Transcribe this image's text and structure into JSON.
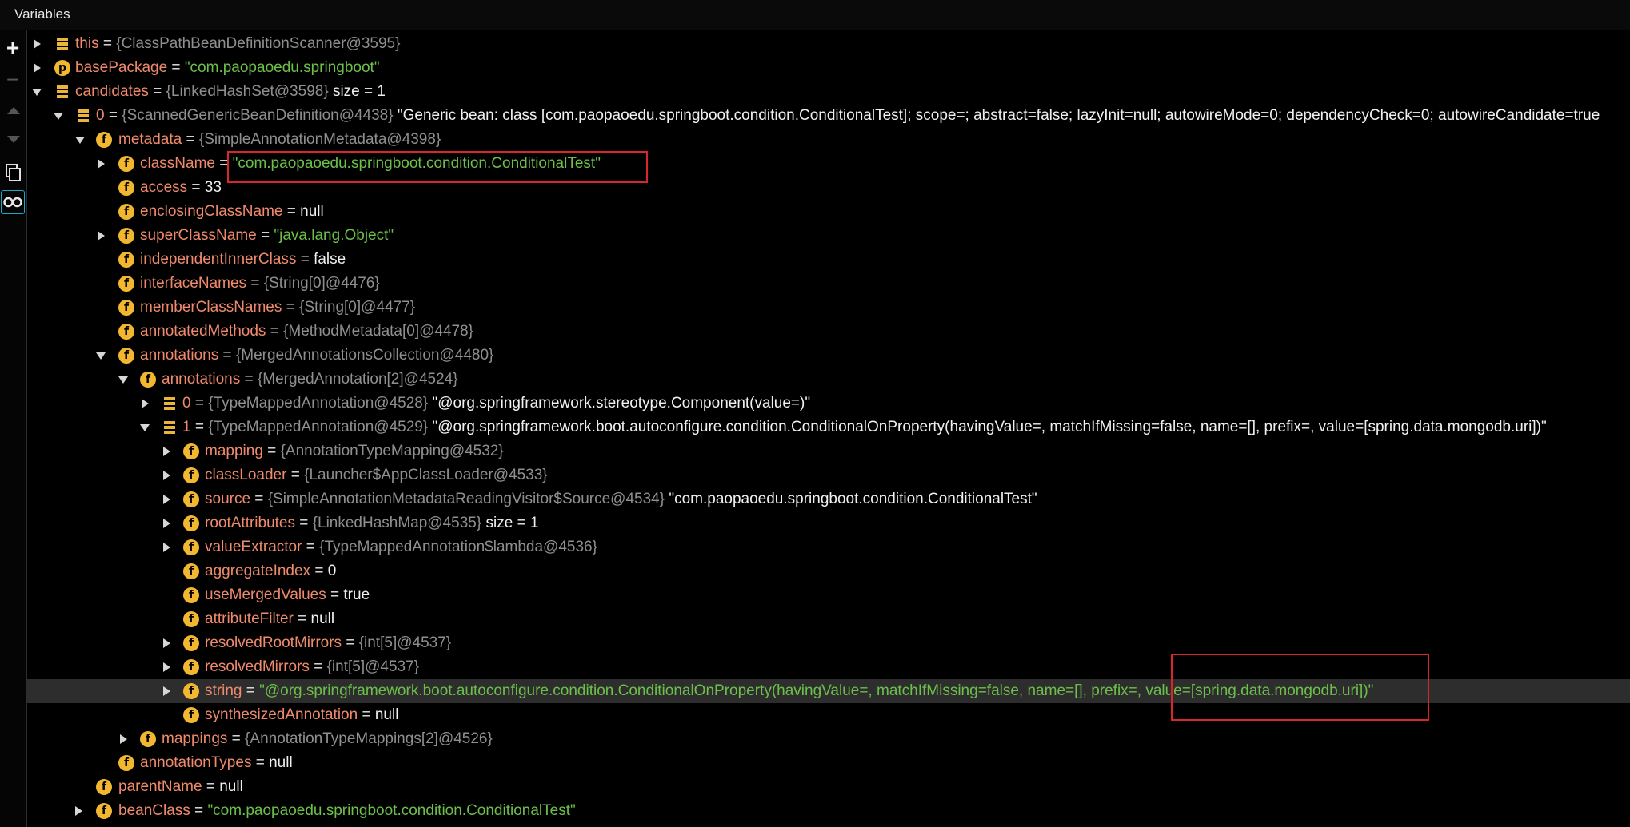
{
  "panel": {
    "title": "Variables"
  },
  "toolbar": {
    "add": "+",
    "remove": "−"
  },
  "rows": [
    {
      "name": "this",
      "ref": "{ClassPathBeanDefinitionScanner@3595}"
    },
    {
      "name": "basePackage",
      "icon_label": "p",
      "value": "\"com.paopaoedu.springboot\""
    },
    {
      "name": "candidates",
      "ref": "{LinkedHashSet@3598}",
      "extra": " size = 1"
    },
    {
      "name": "0",
      "ref": "{ScannedGenericBeanDefinition@4438}",
      "value": " \"Generic bean: class [com.paopaoedu.springboot.condition.ConditionalTest]; scope=; abstract=false; lazyInit=null; autowireMode=0; dependencyCheck=0; autowireCandidate=true"
    },
    {
      "name": "metadata",
      "icon_label": "f",
      "ref": "{SimpleAnnotationMetadata@4398}"
    },
    {
      "name": "className",
      "icon_label": "f",
      "value": "\"com.paopaoedu.springboot.condition.ConditionalTest\""
    },
    {
      "name": "access",
      "icon_label": "f",
      "value": "33"
    },
    {
      "name": "enclosingClassName",
      "icon_label": "f",
      "value": "null"
    },
    {
      "name": "superClassName",
      "icon_label": "f",
      "value": "\"java.lang.Object\""
    },
    {
      "name": "independentInnerClass",
      "icon_label": "f",
      "value": "false"
    },
    {
      "name": "interfaceNames",
      "icon_label": "f",
      "ref": "{String[0]@4476}"
    },
    {
      "name": "memberClassNames",
      "icon_label": "f",
      "ref": "{String[0]@4477}"
    },
    {
      "name": "annotatedMethods",
      "icon_label": "f",
      "ref": "{MethodMetadata[0]@4478}"
    },
    {
      "name": "annotations",
      "icon_label": "f",
      "ref": "{MergedAnnotationsCollection@4480}"
    },
    {
      "name": "annotations",
      "icon_label": "f",
      "ref": "{MergedAnnotation[2]@4524}"
    },
    {
      "name": "0",
      "ref": "{TypeMappedAnnotation@4528}",
      "value": " \"@org.springframework.stereotype.Component(value=)\""
    },
    {
      "name": "1",
      "ref": "{TypeMappedAnnotation@4529}",
      "value": " \"@org.springframework.boot.autoconfigure.condition.ConditionalOnProperty(havingValue=, matchIfMissing=false, name=[], prefix=, value=[spring.data.mongodb.uri])\""
    },
    {
      "name": "mapping",
      "icon_label": "f",
      "ref": "{AnnotationTypeMapping@4532}"
    },
    {
      "name": "classLoader",
      "icon_label": "f",
      "ref": "{Launcher$AppClassLoader@4533}"
    },
    {
      "name": "source",
      "icon_label": "f",
      "ref": "{SimpleAnnotationMetadataReadingVisitor$Source@4534}",
      "value": " \"com.paopaoedu.springboot.condition.ConditionalTest\""
    },
    {
      "name": "rootAttributes",
      "icon_label": "f",
      "ref": "{LinkedHashMap@4535}",
      "extra": "  size = 1"
    },
    {
      "name": "valueExtractor",
      "icon_label": "f",
      "ref": "{TypeMappedAnnotation$lambda@4536}"
    },
    {
      "name": "aggregateIndex",
      "icon_label": "f",
      "value": "0"
    },
    {
      "name": "useMergedValues",
      "icon_label": "f",
      "value": "true"
    },
    {
      "name": "attributeFilter",
      "icon_label": "f",
      "value": "null"
    },
    {
      "name": "resolvedRootMirrors",
      "icon_label": "f",
      "ref": "{int[5]@4537}"
    },
    {
      "name": "resolvedMirrors",
      "icon_label": "f",
      "ref": "{int[5]@4537}"
    },
    {
      "name": "string",
      "icon_label": "f",
      "value": "\"@org.springframework.boot.autoconfigure.condition.ConditionalOnProperty(havingValue=, matchIfMissing=false, name=[], prefix=, value=[spring.data.mongodb.uri])\""
    },
    {
      "name": "synthesizedAnnotation",
      "icon_label": "f",
      "value": "null"
    },
    {
      "name": "mappings",
      "icon_label": "f",
      "ref": "{AnnotationTypeMappings[2]@4526}"
    },
    {
      "name": "annotationTypes",
      "icon_label": "f",
      "value": "null"
    },
    {
      "name": "parentName",
      "icon_label": "f",
      "value": "null"
    },
    {
      "name": "beanClass",
      "icon_label": "f",
      "value": "\"com.paopaoedu.springboot.condition.ConditionalTest\""
    }
  ],
  "colors": {
    "field_name": "#f08a6c",
    "string_value": "#6cc04a",
    "reference": "#8f8f8f",
    "highlight_box": "#d8262b",
    "field_icon": "#f2b731"
  }
}
